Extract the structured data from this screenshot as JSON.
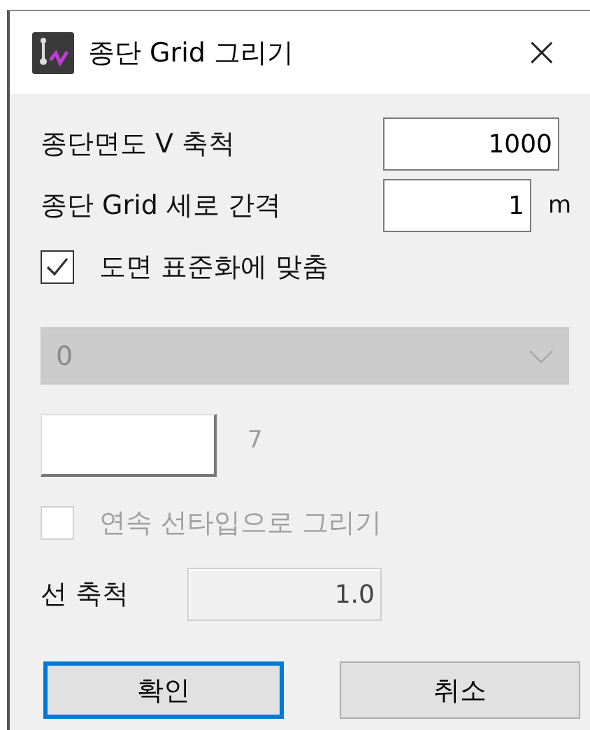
{
  "window": {
    "title": "종단 Grid 그리기",
    "close": "×"
  },
  "fields": [
    {
      "label": "종단면도 V 축척",
      "value": "1000"
    },
    {
      "label": "종단 Grid 세로 간격",
      "value": "1",
      "unit": "m"
    }
  ],
  "fit_checkbox": {
    "label": "도면 표준화에 맞춤",
    "checked": true,
    "disabled": false
  },
  "dropdown": {
    "value": "0",
    "disabled": true
  },
  "color": {
    "number": "7",
    "disabled": true
  },
  "continuous_checkbox": {
    "label": "연속 선타입으로 그리기",
    "checked": false,
    "disabled": true
  },
  "line_scale": {
    "label": "선 축척",
    "value": "1.0",
    "disabled": true
  },
  "buttons": [
    {
      "label": "확인",
      "default": true
    },
    {
      "label": "취소",
      "default": false
    }
  ]
}
